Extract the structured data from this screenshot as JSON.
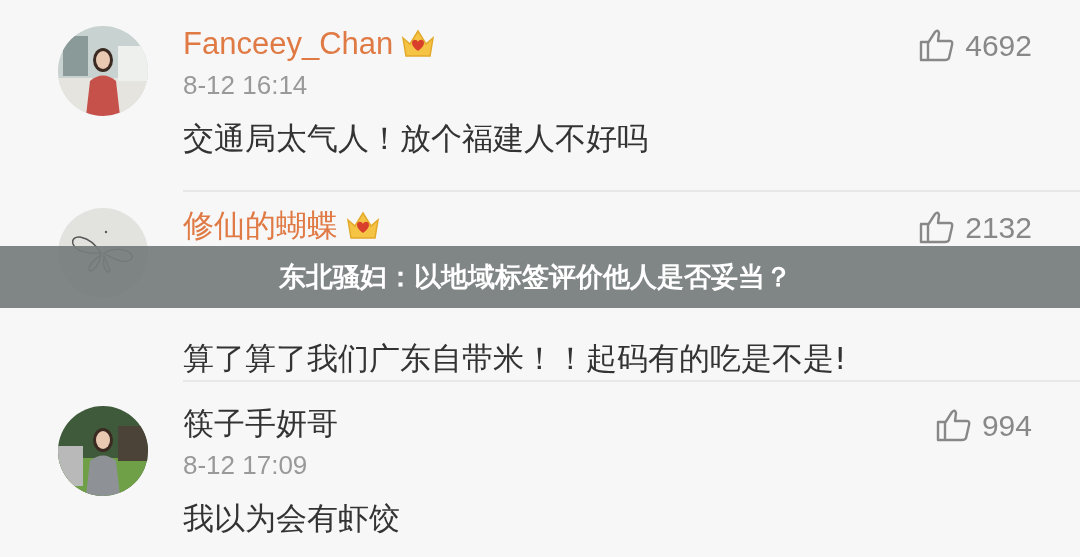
{
  "comments": [
    {
      "user": "Fanceey_Chan",
      "vip": true,
      "time": "8-12 16:14",
      "text": "交通局太气人！放个福建人不好吗",
      "likes": "4692"
    },
    {
      "user": "修仙的蝴蝶",
      "vip": true,
      "text": "算了算了我们广东自带米！！起码有的吃是不是!",
      "likes": "2132",
      "avatar": {
        "kind": "butterfly"
      }
    },
    {
      "user": "筷子手妍哥",
      "vip": false,
      "time": "8-12 17:09",
      "text": "我以为会有虾饺",
      "likes": "994"
    }
  ],
  "banner": {
    "title": "东北骚妇：以地域标签评价他人是否妥当？"
  }
}
